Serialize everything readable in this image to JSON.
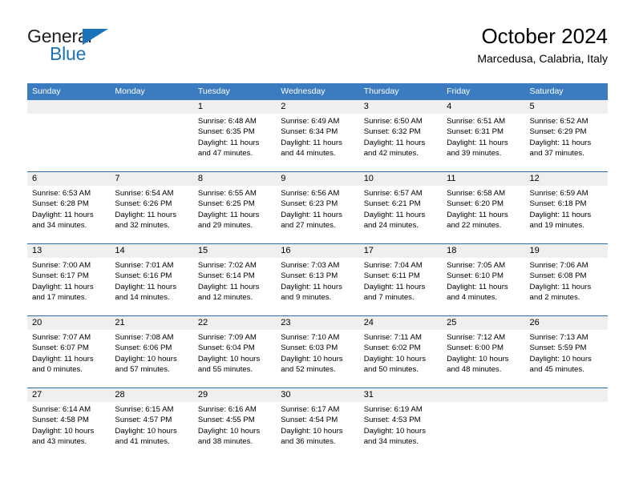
{
  "brand": {
    "name_top": "General",
    "name_bottom": "Blue",
    "triangle_color": "#1b72b8",
    "text_color": "#231f20"
  },
  "header": {
    "title": "October 2024",
    "subtitle": "Marcedusa, Calabria, Italy"
  },
  "theme": {
    "header_bg": "#3b7cc0",
    "header_text": "#ffffff",
    "row_border": "#2e6da4",
    "daynum_band": "#efefef",
    "page_bg": "#ffffff"
  },
  "calendar": {
    "weekdays": [
      "Sunday",
      "Monday",
      "Tuesday",
      "Wednesday",
      "Thursday",
      "Friday",
      "Saturday"
    ],
    "labels": {
      "sunrise": "Sunrise:",
      "sunset": "Sunset:",
      "daylight": "Daylight:"
    },
    "weeks": [
      [
        {
          "day": "",
          "lines": []
        },
        {
          "day": "",
          "lines": []
        },
        {
          "day": "1",
          "lines": [
            "Sunrise: 6:48 AM",
            "Sunset: 6:35 PM",
            "Daylight: 11 hours and 47 minutes."
          ]
        },
        {
          "day": "2",
          "lines": [
            "Sunrise: 6:49 AM",
            "Sunset: 6:34 PM",
            "Daylight: 11 hours and 44 minutes."
          ]
        },
        {
          "day": "3",
          "lines": [
            "Sunrise: 6:50 AM",
            "Sunset: 6:32 PM",
            "Daylight: 11 hours and 42 minutes."
          ]
        },
        {
          "day": "4",
          "lines": [
            "Sunrise: 6:51 AM",
            "Sunset: 6:31 PM",
            "Daylight: 11 hours and 39 minutes."
          ]
        },
        {
          "day": "5",
          "lines": [
            "Sunrise: 6:52 AM",
            "Sunset: 6:29 PM",
            "Daylight: 11 hours and 37 minutes."
          ]
        }
      ],
      [
        {
          "day": "6",
          "lines": [
            "Sunrise: 6:53 AM",
            "Sunset: 6:28 PM",
            "Daylight: 11 hours and 34 minutes."
          ]
        },
        {
          "day": "7",
          "lines": [
            "Sunrise: 6:54 AM",
            "Sunset: 6:26 PM",
            "Daylight: 11 hours and 32 minutes."
          ]
        },
        {
          "day": "8",
          "lines": [
            "Sunrise: 6:55 AM",
            "Sunset: 6:25 PM",
            "Daylight: 11 hours and 29 minutes."
          ]
        },
        {
          "day": "9",
          "lines": [
            "Sunrise: 6:56 AM",
            "Sunset: 6:23 PM",
            "Daylight: 11 hours and 27 minutes."
          ]
        },
        {
          "day": "10",
          "lines": [
            "Sunrise: 6:57 AM",
            "Sunset: 6:21 PM",
            "Daylight: 11 hours and 24 minutes."
          ]
        },
        {
          "day": "11",
          "lines": [
            "Sunrise: 6:58 AM",
            "Sunset: 6:20 PM",
            "Daylight: 11 hours and 22 minutes."
          ]
        },
        {
          "day": "12",
          "lines": [
            "Sunrise: 6:59 AM",
            "Sunset: 6:18 PM",
            "Daylight: 11 hours and 19 minutes."
          ]
        }
      ],
      [
        {
          "day": "13",
          "lines": [
            "Sunrise: 7:00 AM",
            "Sunset: 6:17 PM",
            "Daylight: 11 hours and 17 minutes."
          ]
        },
        {
          "day": "14",
          "lines": [
            "Sunrise: 7:01 AM",
            "Sunset: 6:16 PM",
            "Daylight: 11 hours and 14 minutes."
          ]
        },
        {
          "day": "15",
          "lines": [
            "Sunrise: 7:02 AM",
            "Sunset: 6:14 PM",
            "Daylight: 11 hours and 12 minutes."
          ]
        },
        {
          "day": "16",
          "lines": [
            "Sunrise: 7:03 AM",
            "Sunset: 6:13 PM",
            "Daylight: 11 hours and 9 minutes."
          ]
        },
        {
          "day": "17",
          "lines": [
            "Sunrise: 7:04 AM",
            "Sunset: 6:11 PM",
            "Daylight: 11 hours and 7 minutes."
          ]
        },
        {
          "day": "18",
          "lines": [
            "Sunrise: 7:05 AM",
            "Sunset: 6:10 PM",
            "Daylight: 11 hours and 4 minutes."
          ]
        },
        {
          "day": "19",
          "lines": [
            "Sunrise: 7:06 AM",
            "Sunset: 6:08 PM",
            "Daylight: 11 hours and 2 minutes."
          ]
        }
      ],
      [
        {
          "day": "20",
          "lines": [
            "Sunrise: 7:07 AM",
            "Sunset: 6:07 PM",
            "Daylight: 11 hours and 0 minutes."
          ]
        },
        {
          "day": "21",
          "lines": [
            "Sunrise: 7:08 AM",
            "Sunset: 6:06 PM",
            "Daylight: 10 hours and 57 minutes."
          ]
        },
        {
          "day": "22",
          "lines": [
            "Sunrise: 7:09 AM",
            "Sunset: 6:04 PM",
            "Daylight: 10 hours and 55 minutes."
          ]
        },
        {
          "day": "23",
          "lines": [
            "Sunrise: 7:10 AM",
            "Sunset: 6:03 PM",
            "Daylight: 10 hours and 52 minutes."
          ]
        },
        {
          "day": "24",
          "lines": [
            "Sunrise: 7:11 AM",
            "Sunset: 6:02 PM",
            "Daylight: 10 hours and 50 minutes."
          ]
        },
        {
          "day": "25",
          "lines": [
            "Sunrise: 7:12 AM",
            "Sunset: 6:00 PM",
            "Daylight: 10 hours and 48 minutes."
          ]
        },
        {
          "day": "26",
          "lines": [
            "Sunrise: 7:13 AM",
            "Sunset: 5:59 PM",
            "Daylight: 10 hours and 45 minutes."
          ]
        }
      ],
      [
        {
          "day": "27",
          "lines": [
            "Sunrise: 6:14 AM",
            "Sunset: 4:58 PM",
            "Daylight: 10 hours and 43 minutes."
          ]
        },
        {
          "day": "28",
          "lines": [
            "Sunrise: 6:15 AM",
            "Sunset: 4:57 PM",
            "Daylight: 10 hours and 41 minutes."
          ]
        },
        {
          "day": "29",
          "lines": [
            "Sunrise: 6:16 AM",
            "Sunset: 4:55 PM",
            "Daylight: 10 hours and 38 minutes."
          ]
        },
        {
          "day": "30",
          "lines": [
            "Sunrise: 6:17 AM",
            "Sunset: 4:54 PM",
            "Daylight: 10 hours and 36 minutes."
          ]
        },
        {
          "day": "31",
          "lines": [
            "Sunrise: 6:19 AM",
            "Sunset: 4:53 PM",
            "Daylight: 10 hours and 34 minutes."
          ]
        },
        {
          "day": "",
          "lines": []
        },
        {
          "day": "",
          "lines": []
        }
      ]
    ]
  }
}
